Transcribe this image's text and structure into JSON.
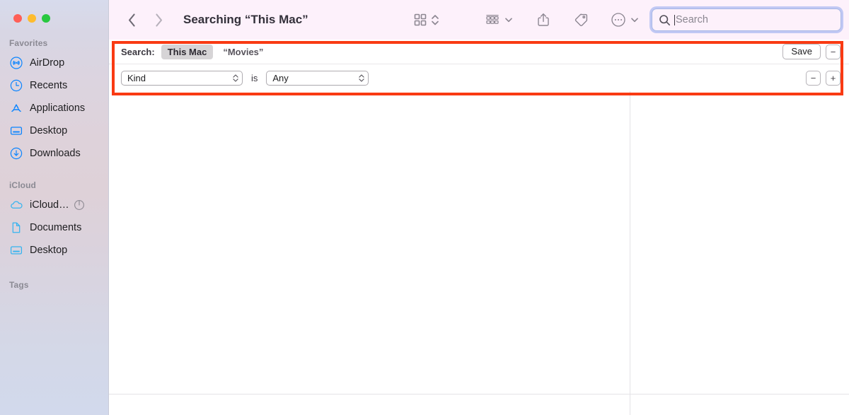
{
  "window": {
    "title": "Searching “This Mac”",
    "traffic_lights": {
      "close_color": "#ff5f57",
      "minimize_color": "#febc2e",
      "zoom_color": "#28c840"
    }
  },
  "toolbar": {
    "back_icon": "chevron-left-icon",
    "forward_icon": "chevron-right-icon",
    "view_icon": "icon-view-grid-icon",
    "view_stepper_icon": "chevron-up-down-icon",
    "group_icon": "group-by-icon",
    "group_chevron_icon": "chevron-down-icon",
    "share_icon": "share-icon",
    "tag_icon": "tag-icon",
    "more_icon": "ellipsis-circle-icon",
    "more_chevron_icon": "chevron-down-icon"
  },
  "search": {
    "icon": "search-icon",
    "placeholder": "Search",
    "value": ""
  },
  "sidebar": {
    "sections": [
      {
        "title": "Favorites",
        "items": [
          {
            "label": "AirDrop",
            "icon": "airdrop-icon"
          },
          {
            "label": "Recents",
            "icon": "clock-icon"
          },
          {
            "label": "Applications",
            "icon": "applications-icon"
          },
          {
            "label": "Desktop",
            "icon": "desktop-icon"
          },
          {
            "label": "Downloads",
            "icon": "downloads-icon"
          }
        ]
      },
      {
        "title": "iCloud",
        "items": [
          {
            "label": "iCloud…",
            "icon": "cloud-icon",
            "progress_icon": "sync-progress-icon"
          },
          {
            "label": "Documents",
            "icon": "document-icon"
          },
          {
            "label": "Desktop",
            "icon": "desktop-icon"
          }
        ]
      },
      {
        "title": "Tags",
        "items": []
      }
    ]
  },
  "criteria": {
    "search_label": "Search:",
    "scopes": [
      {
        "label": "This Mac",
        "selected": true
      },
      {
        "label": "“Movies”",
        "selected": false
      }
    ],
    "save_label": "Save",
    "remove_scope_label": "−",
    "rows": [
      {
        "attribute": "Kind",
        "operator": "is",
        "value": "Any",
        "remove_label": "−",
        "add_label": "+"
      }
    ],
    "highlight_color": "#f93a13"
  }
}
